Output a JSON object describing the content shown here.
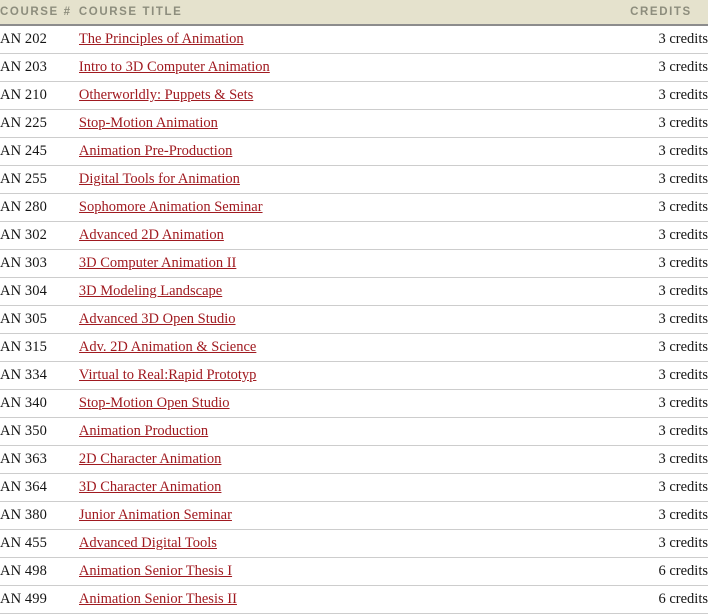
{
  "table": {
    "headers": {
      "course_number": "COURSE #",
      "course_title": "COURSE TITLE",
      "credits": "CREDITS"
    },
    "colors": {
      "header_background": "#e5e2cd",
      "header_text": "#8d8d7d",
      "header_border": "#8c8c8c",
      "row_border": "#cdcdcd",
      "link": "#a01a20",
      "body_text": "#141414",
      "page_background": "#ffffff"
    },
    "rows": [
      {
        "number": "AN 202",
        "title": "The Principles of Animation",
        "credits": "3 credits"
      },
      {
        "number": "AN 203",
        "title": "Intro to 3D Computer Animation",
        "credits": "3 credits"
      },
      {
        "number": "AN 210",
        "title": "Otherworldly: Puppets & Sets",
        "credits": "3 credits"
      },
      {
        "number": "AN 225",
        "title": "Stop-Motion Animation",
        "credits": "3 credits"
      },
      {
        "number": "AN 245",
        "title": "Animation Pre-Production",
        "credits": "3 credits"
      },
      {
        "number": "AN 255",
        "title": "Digital Tools for Animation",
        "credits": "3 credits"
      },
      {
        "number": "AN 280",
        "title": "Sophomore Animation Seminar",
        "credits": "3 credits"
      },
      {
        "number": "AN 302",
        "title": "Advanced 2D Animation",
        "credits": "3 credits"
      },
      {
        "number": "AN 303",
        "title": "3D Computer Animation II",
        "credits": "3 credits"
      },
      {
        "number": "AN 304",
        "title": "3D Modeling Landscape",
        "credits": "3 credits"
      },
      {
        "number": "AN 305",
        "title": "Advanced 3D Open Studio",
        "credits": "3 credits"
      },
      {
        "number": "AN 315",
        "title": "Adv. 2D Animation & Science",
        "credits": "3 credits"
      },
      {
        "number": "AN 334",
        "title": "Virtual to Real:Rapid Prototyp",
        "credits": "3 credits"
      },
      {
        "number": "AN 340",
        "title": "Stop-Motion Open Studio",
        "credits": "3 credits"
      },
      {
        "number": "AN 350",
        "title": "Animation Production",
        "credits": "3 credits"
      },
      {
        "number": "AN 363",
        "title": "2D Character Animation",
        "credits": "3 credits"
      },
      {
        "number": "AN 364",
        "title": "3D Character Animation",
        "credits": "3 credits"
      },
      {
        "number": "AN 380",
        "title": "Junior Animation Seminar",
        "credits": "3 credits"
      },
      {
        "number": "AN 455",
        "title": "Advanced Digital Tools",
        "credits": "3 credits"
      },
      {
        "number": "AN 498",
        "title": "Animation Senior Thesis I",
        "credits": "6 credits"
      },
      {
        "number": "AN 499",
        "title": "Animation Senior Thesis II",
        "credits": "6 credits"
      }
    ]
  }
}
